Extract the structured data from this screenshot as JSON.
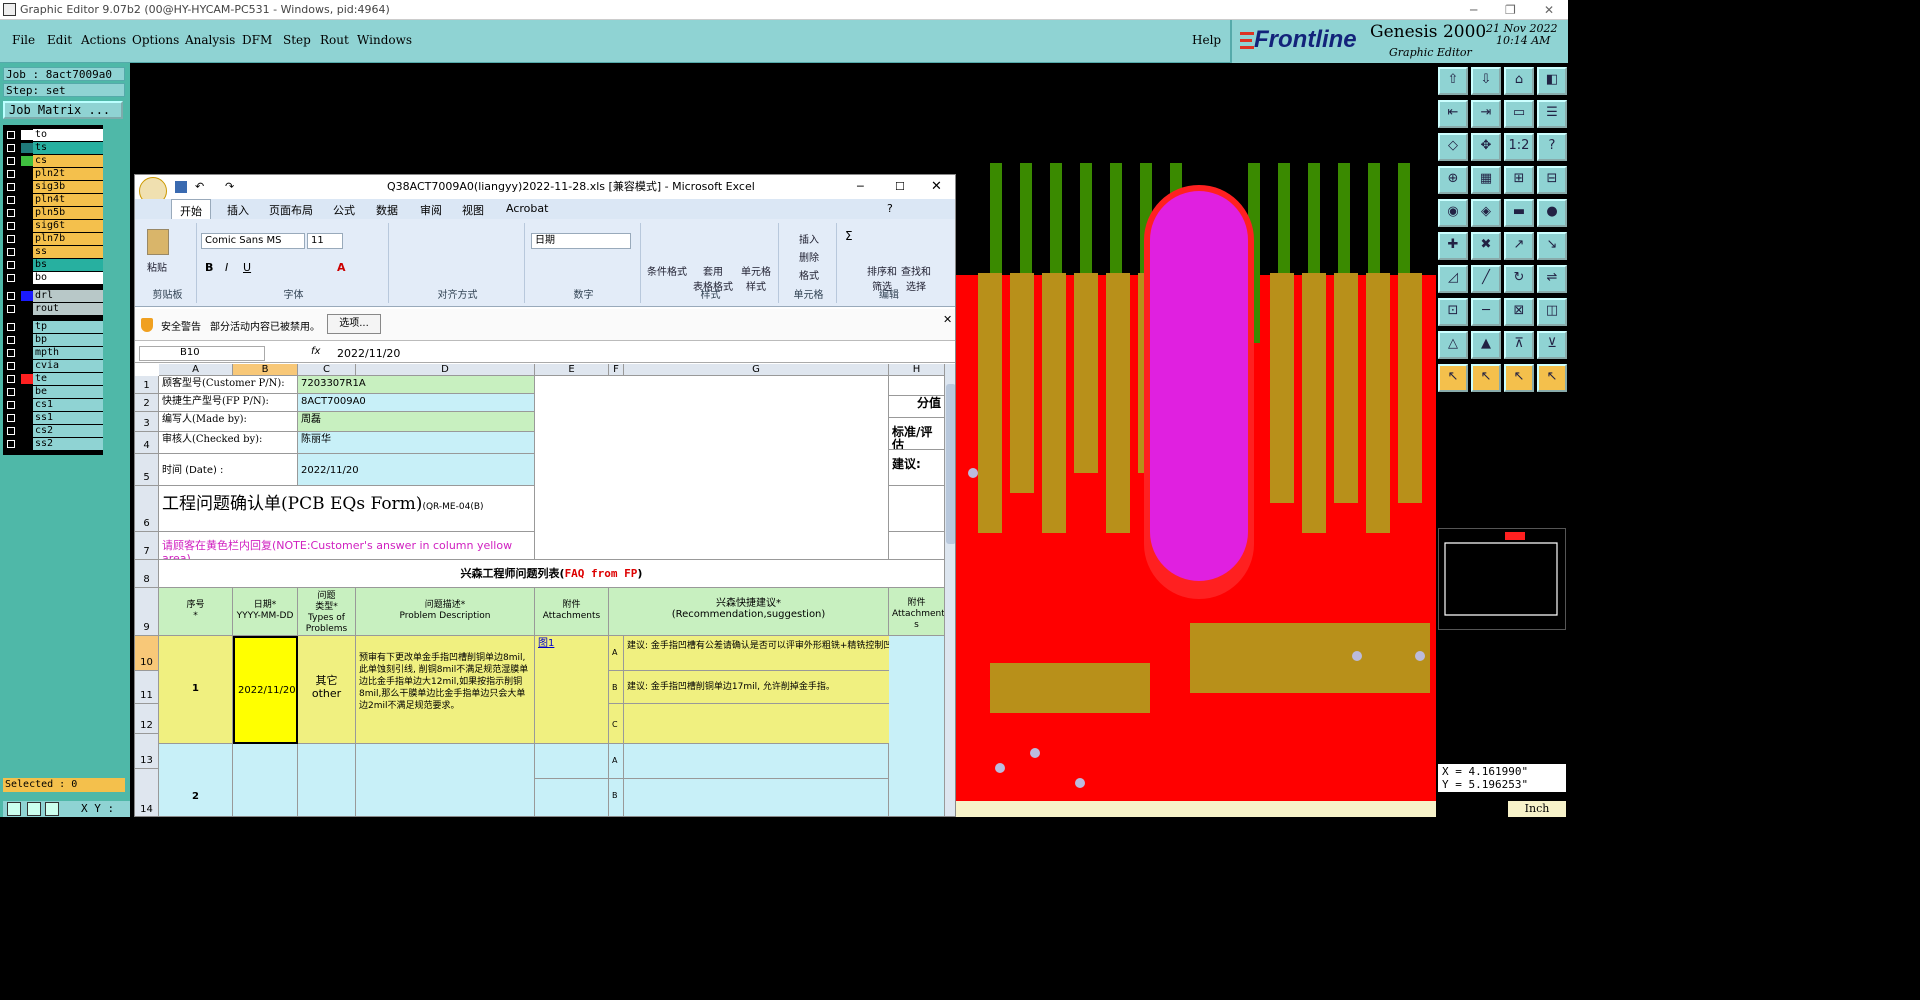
{
  "window": {
    "title": "Graphic Editor 9.07b2 (00@HY-HYCAM-PC531 - Windows, pid:4964)",
    "minimize": "─",
    "maximize": "❐",
    "close": "✕"
  },
  "menu": {
    "items": [
      "File",
      "Edit",
      "Actions",
      "Options",
      "Analysis",
      "DFM",
      "Step",
      "Rout",
      "Windows"
    ],
    "help": "Help"
  },
  "logo": {
    "brand": "Frontline",
    "product": "Genesis 2000",
    "subtitle": "Graphic Editor",
    "date": "21 Nov 2022",
    "time": "10:14 AM"
  },
  "job": {
    "job_label": "Job : 8act7009a0",
    "step_label": "Step: set",
    "matrix_button": "Job Matrix ..."
  },
  "layers": [
    {
      "name": "to",
      "color": "#fff",
      "bg": "#ffffff"
    },
    {
      "name": "ts",
      "color": "#1f7a7a",
      "bg": "#27b0a0"
    },
    {
      "name": "cs",
      "color": "#3fbf3f",
      "bg": "#f4c04c"
    },
    {
      "name": "pln2t",
      "color": "#000",
      "bg": "#f4c04c"
    },
    {
      "name": "sig3b",
      "color": "#000",
      "bg": "#f4c04c"
    },
    {
      "name": "pln4t",
      "color": "#000",
      "bg": "#f4c04c"
    },
    {
      "name": "pln5b",
      "color": "#000",
      "bg": "#f4c04c"
    },
    {
      "name": "sig6t",
      "color": "#000",
      "bg": "#f4c04c"
    },
    {
      "name": "pln7b",
      "color": "#000",
      "bg": "#f4c04c"
    },
    {
      "name": "ss",
      "color": "#000",
      "bg": "#f4c04c"
    },
    {
      "name": "bs",
      "color": "#000",
      "bg": "#27b0a0"
    },
    {
      "name": "bo",
      "color": "#000",
      "bg": "#ffffff"
    },
    {
      "name": "drl",
      "color": "#1a1aff",
      "bg": "#b8c8c8"
    },
    {
      "name": "rout",
      "color": "#000",
      "bg": "#b8c8c8"
    },
    {
      "name": "tp",
      "color": "#000",
      "bg": "#8fd3d3"
    },
    {
      "name": "bp",
      "color": "#000",
      "bg": "#8fd3d3"
    },
    {
      "name": "mpth",
      "color": "#000",
      "bg": "#8fd3d3"
    },
    {
      "name": "cvia",
      "color": "#000",
      "bg": "#8fd3d3"
    },
    {
      "name": "te",
      "color": "#ff2020",
      "bg": "#8fd3d3"
    },
    {
      "name": "be",
      "color": "#000",
      "bg": "#8fd3d3"
    },
    {
      "name": "cs1",
      "color": "#000",
      "bg": "#8fd3d3"
    },
    {
      "name": "ss1",
      "color": "#000",
      "bg": "#8fd3d3"
    },
    {
      "name": "cs2",
      "color": "#000",
      "bg": "#8fd3d3"
    },
    {
      "name": "ss2",
      "color": "#000",
      "bg": "#8fd3d3"
    }
  ],
  "status": {
    "selected": "Selected : 0",
    "xy_label": "X Y :",
    "coord_x": "X = 4.161990\"",
    "coord_y": "Y = 5.196253\"",
    "units": "Inch"
  },
  "excel": {
    "title": "Q38ACT7009A0(liangyy)2022-11-28.xls  [兼容模式] - Microsoft Excel",
    "tabs": [
      "开始",
      "插入",
      "页面布局",
      "公式",
      "数据",
      "审阅",
      "视图",
      "Acrobat"
    ],
    "font_name": "Comic Sans MS",
    "font_size": "11",
    "number_format": "日期",
    "groups": [
      "剪贴板",
      "字体",
      "对齐方式",
      "数字",
      "样式",
      "单元格",
      "编辑"
    ],
    "paste": "粘贴",
    "styles_buttons": [
      "条件格式",
      "套用\n表格格式",
      "单元格\n样式"
    ],
    "cell_buttons": [
      "插入",
      "删除",
      "格式"
    ],
    "edit_buttons": [
      "排序和\n筛选",
      "查找和\n选择"
    ],
    "security_title": "安全警告",
    "security_text": "部分活动内容已被禁用。",
    "security_button": "选项...",
    "name_box": "B10",
    "formula": "2022/11/20",
    "col_headers": [
      "A",
      "B",
      "C",
      "D",
      "E",
      "F",
      "G",
      "H"
    ],
    "rows": {
      "r1_label": "顾客型号(Customer P/N):",
      "r1_value": "7203307R1A",
      "r2_label": "快捷生产型号(FP P/N):",
      "r2_value": "8ACT7009A0",
      "r3_label": "编写人(Made by):",
      "r3_value": "周磊",
      "r4_label": "审核人(Checked by):",
      "r4_value": "陈丽华",
      "r5_label": "时间 (Date) :",
      "r5_value": "2022/11/20",
      "h_score": "分值",
      "h_standard": "标准/评估",
      "h_suggest": "建议:",
      "form_title": "工程问题确认单(PCB EQs Form)",
      "form_code": "(QR-ME-04(B)",
      "customer_note": "请顾客在黄色栏内回复(NOTE:Customer's answer in column yellow area)",
      "list_title_a": "兴森工程师问题列表(",
      "list_title_b": "FAQ from FP",
      "list_title_c": ")",
      "th_no": "序号\n*",
      "th_date": "日期*\nYYYY-MM-DD",
      "th_type": "问题\n类型*\nTypes of\nProblems",
      "th_desc": "问题描述*\nProblem Description",
      "th_att": "附件\nAttachments",
      "th_sugg": "兴森快捷建议*\n(Recommendation,suggestion)",
      "th_att2": "附件\nAttachment\ns",
      "item1_no": "1",
      "item1_date": "2022/11/20",
      "item1_type": "其它\nother",
      "item1_desc": "预审有下更改单金手指凹槽削铜单边8mil, 此单蚀刻引线, 削铜8mil不满足规范湿膜单边比金手指单边大12mil,如果按指示削铜8mil,那么干膜单边比金手指单边只会大单边2mil不满足规范要求。",
      "item1_att": "图1",
      "opt_a": "A",
      "opt_b": "B",
      "opt_c": "C",
      "sugg_a": "建议: 金手指凹槽有公差请确认是否可以评审外形粗铣+精铣控制凹槽公差。",
      "sugg_b": "建议: 金手指凹槽削铜单边17mil, 允许削掉金手指。",
      "item2_no": "2",
      "row_nums": [
        "1",
        "2",
        "3",
        "4",
        "5",
        "6",
        "7",
        "8",
        "9",
        "10",
        "11",
        "12",
        "13",
        "14"
      ]
    }
  }
}
